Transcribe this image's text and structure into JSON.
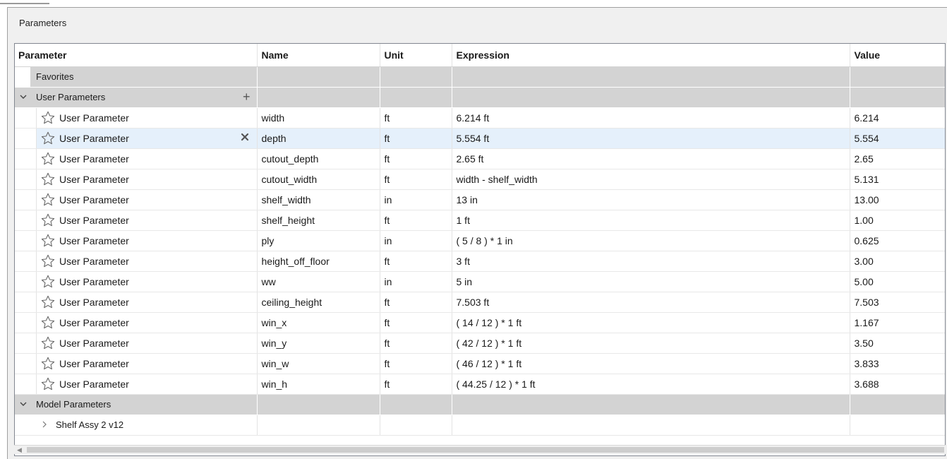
{
  "dialog": {
    "title": "Parameters"
  },
  "columns": [
    "Parameter",
    "Name",
    "Unit",
    "Expression",
    "Value"
  ],
  "groups": {
    "favorites": {
      "label": "Favorites"
    },
    "user": {
      "label": "User Parameters",
      "add_glyph": "+"
    },
    "model": {
      "label": "Model Parameters"
    },
    "shelf": {
      "label": "Shelf Assy 2 v12"
    }
  },
  "rows": [
    {
      "param": "User Parameter",
      "name": "width",
      "unit": "ft",
      "expression": "6.214 ft",
      "value": "6.214"
    },
    {
      "param": "User Parameter",
      "name": "depth",
      "unit": "ft",
      "expression": "5.554 ft",
      "value": "5.554"
    },
    {
      "param": "User Parameter",
      "name": "cutout_depth",
      "unit": "ft",
      "expression": "2.65 ft",
      "value": "2.65"
    },
    {
      "param": "User Parameter",
      "name": "cutout_width",
      "unit": "ft",
      "expression": "width - shelf_width",
      "value": "5.131"
    },
    {
      "param": "User Parameter",
      "name": "shelf_width",
      "unit": "in",
      "expression": "13 in",
      "value": "13.00"
    },
    {
      "param": "User Parameter",
      "name": "shelf_height",
      "unit": "ft",
      "expression": "1 ft",
      "value": "1.00"
    },
    {
      "param": "User Parameter",
      "name": "ply",
      "unit": "in",
      "expression": "( 5 / 8 ) * 1 in",
      "value": "0.625"
    },
    {
      "param": "User Parameter",
      "name": "height_off_floor",
      "unit": "ft",
      "expression": "3 ft",
      "value": "3.00"
    },
    {
      "param": "User Parameter",
      "name": "ww",
      "unit": "in",
      "expression": "5 in",
      "value": "5.00"
    },
    {
      "param": "User Parameter",
      "name": "ceiling_height",
      "unit": "ft",
      "expression": "7.503 ft",
      "value": "7.503"
    },
    {
      "param": "User Parameter",
      "name": "win_x",
      "unit": "ft",
      "expression": "( 14 / 12 ) * 1 ft",
      "value": "1.167"
    },
    {
      "param": "User Parameter",
      "name": "win_y",
      "unit": "ft",
      "expression": "( 42 / 12 ) * 1 ft",
      "value": "3.50"
    },
    {
      "param": "User Parameter",
      "name": "win_w",
      "unit": "ft",
      "expression": "( 46 / 12 ) * 1 ft",
      "value": "3.833"
    },
    {
      "param": "User Parameter",
      "name": "win_h",
      "unit": "ft",
      "expression": "( 44.25 / 12 ) * 1 ft",
      "value": "3.688"
    }
  ],
  "selected_row": 1,
  "icons": {
    "favorite": "star-outline-icon",
    "delete": "close-x-icon",
    "expand": "chevron-down-icon",
    "collapsed": "chevron-right-icon"
  },
  "colors": {
    "group_bg": "#d3d3d3",
    "selected_bg": "#e5f0fb",
    "grid_border": "#828790"
  }
}
